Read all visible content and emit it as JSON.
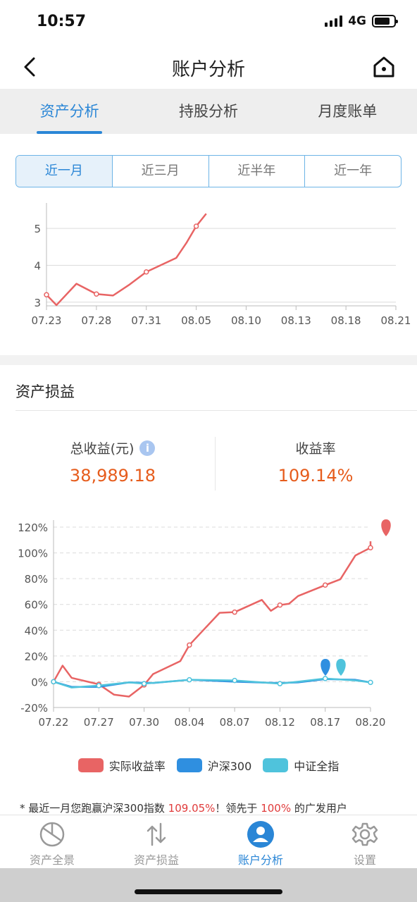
{
  "status": {
    "time": "10:57",
    "network": "4G"
  },
  "nav": {
    "title": "账户分析"
  },
  "tabs": [
    {
      "label": "资产分析",
      "active": true
    },
    {
      "label": "持股分析",
      "active": false
    },
    {
      "label": "月度账单",
      "active": false
    }
  ],
  "range_buttons": [
    {
      "label": "近一月",
      "active": true
    },
    {
      "label": "近三月",
      "active": false
    },
    {
      "label": "近半年",
      "active": false
    },
    {
      "label": "近一年",
      "active": false
    }
  ],
  "pnl": {
    "title": "资产损益",
    "total_label": "总收益(元)",
    "total_value": "38,989.18",
    "rate_label": "收益率",
    "rate_value": "109.14%"
  },
  "legend": [
    {
      "label": "实际收益率",
      "color": "#e86464"
    },
    {
      "label": "沪深300",
      "color": "#2f8fe0"
    },
    {
      "label": "中证全指",
      "color": "#4fc3dc"
    }
  ],
  "footnote": {
    "prefix": "* 最近一月您跑赢沪深300指数 ",
    "beat_value": "109.05%",
    "middle": "！领先于 ",
    "lead_value": "100%",
    "suffix": " 的广发用户"
  },
  "tabbar": [
    {
      "label": "资产全景",
      "icon": "pie-chart-icon",
      "active": false
    },
    {
      "label": "资产损益",
      "icon": "up-down-arrows-icon",
      "active": false
    },
    {
      "label": "账户分析",
      "icon": "user-icon",
      "active": true
    },
    {
      "label": "设置",
      "icon": "gear-icon",
      "active": false
    }
  ],
  "chart_data": [
    {
      "type": "line",
      "title": "",
      "x_ticks": [
        "07.23",
        "07.28",
        "07.31",
        "08.05",
        "08.10",
        "08.13",
        "08.18",
        "08.21"
      ],
      "y_ticks": [
        3,
        4,
        5
      ],
      "ylim": [
        2.9,
        5.5
      ],
      "grid": true,
      "series": [
        {
          "color": "#e86464",
          "points": [
            [
              "07.23",
              3.2
            ],
            [
              "07.24",
              2.92
            ],
            [
              "07.26",
              3.5
            ],
            [
              "07.28",
              3.22
            ],
            [
              "07.29",
              3.18
            ],
            [
              "07.30",
              3.48
            ],
            [
              "07.31",
              3.82
            ],
            [
              "08.03",
              4.2
            ],
            [
              "08.04",
              4.6
            ],
            [
              "08.05",
              5.06
            ],
            [
              "08.06",
              5.4
            ]
          ],
          "markers": [
            "07.23",
            "07.28",
            "07.31",
            "08.05"
          ]
        }
      ]
    },
    {
      "type": "line",
      "title": "",
      "x_ticks": [
        "07.22",
        "07.27",
        "07.30",
        "08.04",
        "08.07",
        "08.12",
        "08.17",
        "08.20"
      ],
      "y_ticks": [
        "-20%",
        "0%",
        "20%",
        "40%",
        "60%",
        "80%",
        "100%",
        "120%"
      ],
      "ylim": [
        -20,
        120
      ],
      "grid": true,
      "series": [
        {
          "name": "实际收益率",
          "color": "#e86464",
          "points": [
            [
              "07.22",
              0
            ],
            [
              "07.23",
              12.5
            ],
            [
              "07.24",
              3
            ],
            [
              "07.27",
              -2
            ],
            [
              "07.28",
              -10
            ],
            [
              "07.29",
              -11.5
            ],
            [
              "07.30",
              -2.5
            ],
            [
              "07.31",
              6
            ],
            [
              "08.03",
              16
            ],
            [
              "08.04",
              28.5
            ],
            [
              "08.05",
              41
            ],
            [
              "08.06",
              53.5
            ],
            [
              "08.07",
              54
            ],
            [
              "08.10",
              63.5
            ],
            [
              "08.11",
              55
            ],
            [
              "08.12",
              59.5
            ],
            [
              "08.13",
              60.5
            ],
            [
              "08.14",
              66.5
            ],
            [
              "08.17",
              75
            ],
            [
              "08.18",
              79.5
            ],
            [
              "08.19",
              98
            ],
            [
              "08.20",
              104
            ],
            [
              "08.21",
              109
            ]
          ],
          "markers": [
            "07.22",
            "07.27",
            "07.30",
            "08.04",
            "08.07",
            "08.12",
            "08.17",
            "08.20"
          ]
        },
        {
          "name": "沪深300",
          "color": "#2f8fe0",
          "points": [
            [
              "07.22",
              0
            ],
            [
              "07.24",
              -4
            ],
            [
              "07.27",
              -4
            ],
            [
              "07.29",
              -0.5
            ],
            [
              "07.31",
              -1
            ],
            [
              "08.04",
              1.5
            ],
            [
              "08.07",
              0
            ],
            [
              "08.12",
              -1
            ],
            [
              "08.14",
              -0.5
            ],
            [
              "08.17",
              2
            ],
            [
              "08.19",
              1.5
            ],
            [
              "08.20",
              -0.5
            ],
            [
              "08.21",
              0.5
            ]
          ],
          "markers": []
        },
        {
          "name": "中证全指",
          "color": "#4fc3dc",
          "points": [
            [
              "07.22",
              0
            ],
            [
              "07.24",
              -4.5
            ],
            [
              "07.27",
              -3
            ],
            [
              "07.29",
              -0.5
            ],
            [
              "07.30",
              -1.5
            ],
            [
              "08.04",
              1.5
            ],
            [
              "08.07",
              1
            ],
            [
              "08.12",
              -1.5
            ],
            [
              "08.14",
              0
            ],
            [
              "08.17",
              2.5
            ],
            [
              "08.19",
              1
            ],
            [
              "08.20",
              -0.5
            ],
            [
              "08.21",
              0.5
            ]
          ],
          "markers": [
            "07.22",
            "07.27",
            "07.30",
            "08.04",
            "08.07",
            "08.12",
            "08.17",
            "08.20"
          ]
        }
      ]
    }
  ]
}
